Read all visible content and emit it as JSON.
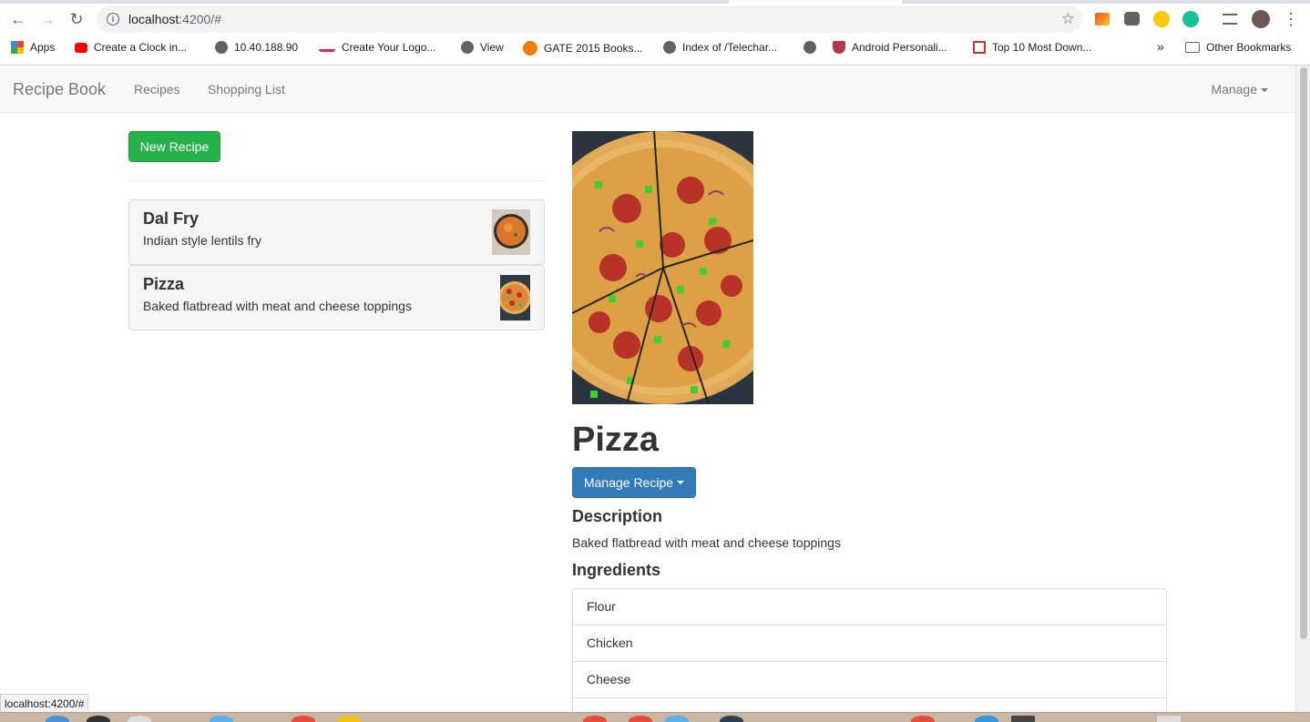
{
  "browser": {
    "url_host": "localhost",
    "url_rest": ":4200/#",
    "status_url": "localhost:4200/#",
    "bookmarks": [
      {
        "label": "Apps",
        "icon": "apps-grid-icon",
        "color": "#ea4335"
      },
      {
        "label": "Create a Clock in...",
        "icon": "youtube-icon",
        "color": "#ff0000"
      },
      {
        "label": "10.40.188.90",
        "icon": "globe-icon",
        "color": "#5f6368"
      },
      {
        "label": "Create Your Logo...",
        "icon": "dm-logo-icon",
        "color": "#e0245e"
      },
      {
        "label": "View",
        "icon": "globe-icon",
        "color": "#5f6368"
      },
      {
        "label": "GATE 2015 Books...",
        "icon": "info-orange-icon",
        "color": "#f57c00"
      },
      {
        "label": "Index of /Telechar...",
        "icon": "globe-icon",
        "color": "#5f6368"
      },
      {
        "label": "",
        "icon": "globe-icon",
        "color": "#5f6368"
      },
      {
        "label": "Android Personali...",
        "icon": "shield-icon",
        "color": "#b23a48"
      },
      {
        "label": "Top 10 Most Down...",
        "icon": "bookmark-red-icon",
        "color": "#d32f2f"
      }
    ],
    "more_bookmarks": "»",
    "other_bookmarks": "Other Bookmarks"
  },
  "navbar": {
    "brand": "Recipe Book",
    "links": [
      "Recipes",
      "Shopping List"
    ],
    "manage": "Manage"
  },
  "left": {
    "new_recipe": "New Recipe",
    "recipes": [
      {
        "name": "Dal Fry",
        "description": "Indian style lentils fry"
      },
      {
        "name": "Pizza",
        "description": "Baked flatbread with meat and cheese toppings"
      }
    ]
  },
  "detail": {
    "title": "Pizza",
    "manage_recipe": "Manage Recipe",
    "description_heading": "Description",
    "description": "Baked flatbread with meat and cheese toppings",
    "ingredients_heading": "Ingredients",
    "ingredients": [
      "Flour",
      "Chicken",
      "Cheese",
      ""
    ]
  },
  "colors": {
    "success": "#26b24a",
    "primary": "#337ab7",
    "navbar_bg": "#f8f8f8"
  }
}
